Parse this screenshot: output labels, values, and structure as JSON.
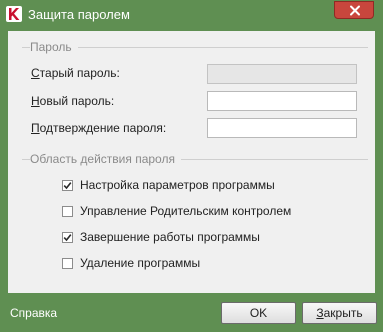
{
  "window": {
    "title": "Защита паролем",
    "brand_color": "#5f8f52",
    "close_color": "#c9463d"
  },
  "password_group": {
    "title": "Пароль",
    "old_password_label": "Старый пароль:",
    "new_password_label": "Новый пароль:",
    "confirm_password_label": "Подтверждение пароля:",
    "old_password_value": "",
    "new_password_value": "",
    "confirm_password_value": ""
  },
  "scope_group": {
    "title": "Область действия пароля",
    "options": [
      {
        "label": "Настройка параметров программы",
        "checked": true
      },
      {
        "label": "Управление Родительским контролем",
        "checked": false
      },
      {
        "label": "Завершение работы программы",
        "checked": true
      },
      {
        "label": "Удаление программы",
        "checked": false
      }
    ]
  },
  "footer": {
    "help_label": "Справка",
    "ok_label": "OK",
    "close_label": "Закрыть"
  }
}
